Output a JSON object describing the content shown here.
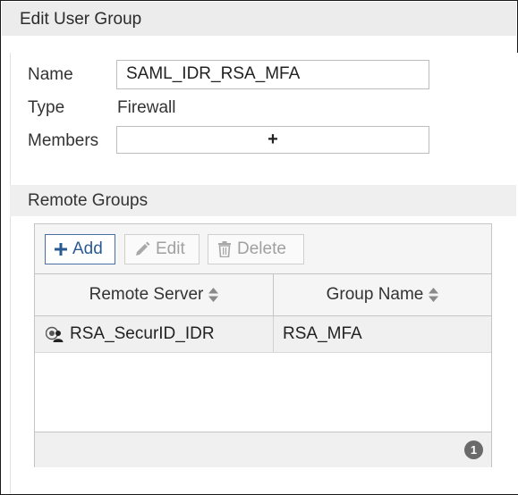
{
  "dialog": {
    "title": "Edit User Group"
  },
  "form": {
    "name_label": "Name",
    "name_value": "SAML_IDR_RSA_MFA",
    "type_label": "Type",
    "type_value": "Firewall",
    "members_label": "Members",
    "members_add_symbol": "+"
  },
  "remote_groups": {
    "section_title": "Remote Groups",
    "toolbar": {
      "add_label": "Add",
      "edit_label": "Edit",
      "delete_label": "Delete"
    },
    "columns": [
      "Remote Server",
      "Group Name"
    ],
    "rows": [
      {
        "server": "RSA_SecurID_IDR",
        "server_icon": "user-server-icon",
        "group": "RSA_MFA"
      }
    ],
    "count": "1"
  },
  "colors": {
    "accent": "#2a5a93",
    "header_bg": "#ececec",
    "badge": "#6a6a6a"
  }
}
